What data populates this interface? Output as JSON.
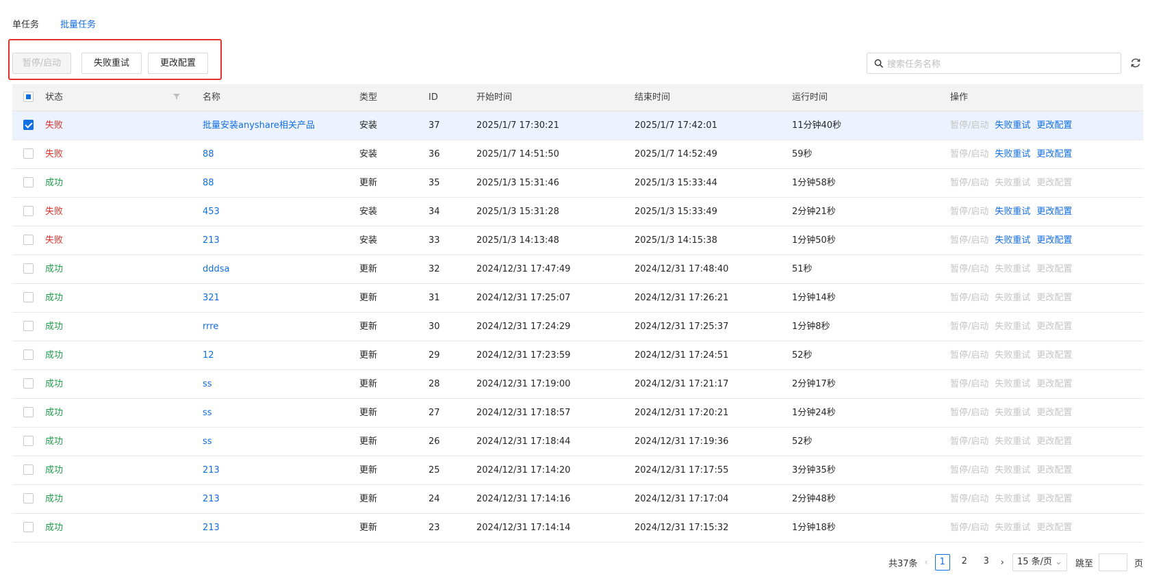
{
  "tabs": [
    {
      "label": "单任务",
      "active": false
    },
    {
      "label": "批量任务",
      "active": true
    }
  ],
  "toolbar": {
    "pause_label": "暂停/启动",
    "retry_label": "失败重试",
    "config_label": "更改配置"
  },
  "search": {
    "placeholder": "搜索任务名称",
    "icon": "search-icon"
  },
  "refresh_icon": "refresh-icon",
  "columns": {
    "status": "状态",
    "name": "名称",
    "type": "类型",
    "id": "ID",
    "start": "开始时间",
    "end": "结束时间",
    "run": "运行时间",
    "ops": "操作"
  },
  "ops_labels": {
    "pause": "暂停/启动",
    "retry": "失败重试",
    "config": "更改配置"
  },
  "rows": [
    {
      "checked": true,
      "status": "失败",
      "name": "批量安装anyshare相关产品",
      "type": "安装",
      "id": "37",
      "start": "2025/1/7 17:30:21",
      "end": "2025/1/7 17:42:01",
      "run": "11分钟40秒"
    },
    {
      "checked": false,
      "status": "失败",
      "name": "88",
      "type": "安装",
      "id": "36",
      "start": "2025/1/7 14:51:50",
      "end": "2025/1/7 14:52:49",
      "run": "59秒"
    },
    {
      "checked": false,
      "status": "成功",
      "name": "88",
      "type": "更新",
      "id": "35",
      "start": "2025/1/3 15:31:46",
      "end": "2025/1/3 15:33:44",
      "run": "1分钟58秒"
    },
    {
      "checked": false,
      "status": "失败",
      "name": "453",
      "type": "安装",
      "id": "34",
      "start": "2025/1/3 15:31:28",
      "end": "2025/1/3 15:33:49",
      "run": "2分钟21秒"
    },
    {
      "checked": false,
      "status": "失败",
      "name": "213",
      "type": "安装",
      "id": "33",
      "start": "2025/1/3 14:13:48",
      "end": "2025/1/3 14:15:38",
      "run": "1分钟50秒"
    },
    {
      "checked": false,
      "status": "成功",
      "name": "dddsa",
      "type": "更新",
      "id": "32",
      "start": "2024/12/31 17:47:49",
      "end": "2024/12/31 17:48:40",
      "run": "51秒"
    },
    {
      "checked": false,
      "status": "成功",
      "name": "321",
      "type": "更新",
      "id": "31",
      "start": "2024/12/31 17:25:07",
      "end": "2024/12/31 17:26:21",
      "run": "1分钟14秒"
    },
    {
      "checked": false,
      "status": "成功",
      "name": "rrre",
      "type": "更新",
      "id": "30",
      "start": "2024/12/31 17:24:29",
      "end": "2024/12/31 17:25:37",
      "run": "1分钟8秒"
    },
    {
      "checked": false,
      "status": "成功",
      "name": "12",
      "type": "更新",
      "id": "29",
      "start": "2024/12/31 17:23:59",
      "end": "2024/12/31 17:24:51",
      "run": "52秒"
    },
    {
      "checked": false,
      "status": "成功",
      "name": "ss",
      "type": "更新",
      "id": "28",
      "start": "2024/12/31 17:19:00",
      "end": "2024/12/31 17:21:17",
      "run": "2分钟17秒"
    },
    {
      "checked": false,
      "status": "成功",
      "name": "ss",
      "type": "更新",
      "id": "27",
      "start": "2024/12/31 17:18:57",
      "end": "2024/12/31 17:20:21",
      "run": "1分钟24秒"
    },
    {
      "checked": false,
      "status": "成功",
      "name": "ss",
      "type": "更新",
      "id": "26",
      "start": "2024/12/31 17:18:44",
      "end": "2024/12/31 17:19:36",
      "run": "52秒"
    },
    {
      "checked": false,
      "status": "成功",
      "name": "213",
      "type": "更新",
      "id": "25",
      "start": "2024/12/31 17:14:20",
      "end": "2024/12/31 17:17:55",
      "run": "3分钟35秒"
    },
    {
      "checked": false,
      "status": "成功",
      "name": "213",
      "type": "更新",
      "id": "24",
      "start": "2024/12/31 17:14:16",
      "end": "2024/12/31 17:17:04",
      "run": "2分钟48秒"
    },
    {
      "checked": false,
      "status": "成功",
      "name": "213",
      "type": "更新",
      "id": "23",
      "start": "2024/12/31 17:14:14",
      "end": "2024/12/31 17:15:32",
      "run": "1分钟18秒"
    }
  ],
  "pagination": {
    "total": "共37条",
    "pages": [
      "1",
      "2",
      "3"
    ],
    "current": "1",
    "page_size": "15 条/页",
    "jump_label": "跳至",
    "page_unit": "页"
  },
  "colors": {
    "accent": "#126ee3",
    "fail": "#e0322a",
    "success": "#1e9e4a",
    "disabled": "#c4c4c4",
    "highlight_box": "#e0322a"
  }
}
